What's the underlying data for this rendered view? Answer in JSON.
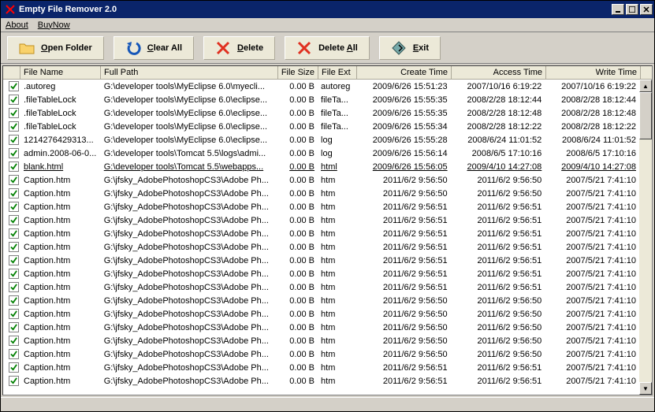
{
  "window": {
    "title": "Empty File Remover 2.0"
  },
  "menu": {
    "about": "About",
    "buynow": "BuyNow"
  },
  "toolbar": {
    "open_folder": "Open Folder",
    "clear_all": "Clear All",
    "delete": "Delete",
    "delete_all": "Delete All",
    "exit": "Exit"
  },
  "columns": {
    "filename": "File Name",
    "fullpath": "Full Path",
    "filesize": "File Size",
    "fileext": "File Ext",
    "create": "Create Time",
    "access": "Access Time",
    "write": "Write Time"
  },
  "selected_index": 6,
  "rows": [
    {
      "f": ".autoreg",
      "p": "G:\\developer tools\\MyEclipse 6.0\\myecli...",
      "s": "0.00 B",
      "e": "autoreg",
      "c": "2009/6/26 15:51:23",
      "a": "2007/10/16 6:19:22",
      "w": "2007/10/16 6:19:22"
    },
    {
      "f": ".fileTableLock",
      "p": "G:\\developer tools\\MyEclipse 6.0\\eclipse...",
      "s": "0.00 B",
      "e": "fileTa...",
      "c": "2009/6/26 15:55:35",
      "a": "2008/2/28 18:12:44",
      "w": "2008/2/28 18:12:44"
    },
    {
      "f": ".fileTableLock",
      "p": "G:\\developer tools\\MyEclipse 6.0\\eclipse...",
      "s": "0.00 B",
      "e": "fileTa...",
      "c": "2009/6/26 15:55:35",
      "a": "2008/2/28 18:12:48",
      "w": "2008/2/28 18:12:48"
    },
    {
      "f": ".fileTableLock",
      "p": "G:\\developer tools\\MyEclipse 6.0\\eclipse...",
      "s": "0.00 B",
      "e": "fileTa...",
      "c": "2009/6/26 15:55:34",
      "a": "2008/2/28 18:12:22",
      "w": "2008/2/28 18:12:22"
    },
    {
      "f": "1214276429313...",
      "p": "G:\\developer tools\\MyEclipse 6.0\\eclipse...",
      "s": "0.00 B",
      "e": "log",
      "c": "2009/6/26 15:55:28",
      "a": "2008/6/24 11:01:52",
      "w": "2008/6/24 11:01:52"
    },
    {
      "f": "admin.2008-06-0...",
      "p": "G:\\developer tools\\Tomcat 5.5\\logs\\admi...",
      "s": "0.00 B",
      "e": "log",
      "c": "2009/6/26 15:56:14",
      "a": "2008/6/5 17:10:16",
      "w": "2008/6/5 17:10:16"
    },
    {
      "f": "blank.html",
      "p": "G:\\developer tools\\Tomcat 5.5\\webapps...",
      "s": "0.00 B",
      "e": "html",
      "c": "2009/6/26 15:56:05",
      "a": "2009/4/10 14:27:08",
      "w": "2009/4/10 14:27:08"
    },
    {
      "f": "Caption.htm",
      "p": "G:\\jfsky_AdobePhotoshopCS3\\Adobe Ph...",
      "s": "0.00 B",
      "e": "htm",
      "c": "2011/6/2 9:56:50",
      "a": "2011/6/2 9:56:50",
      "w": "2007/5/21 7:41:10"
    },
    {
      "f": "Caption.htm",
      "p": "G:\\jfsky_AdobePhotoshopCS3\\Adobe Ph...",
      "s": "0.00 B",
      "e": "htm",
      "c": "2011/6/2 9:56:50",
      "a": "2011/6/2 9:56:50",
      "w": "2007/5/21 7:41:10"
    },
    {
      "f": "Caption.htm",
      "p": "G:\\jfsky_AdobePhotoshopCS3\\Adobe Ph...",
      "s": "0.00 B",
      "e": "htm",
      "c": "2011/6/2 9:56:51",
      "a": "2011/6/2 9:56:51",
      "w": "2007/5/21 7:41:10"
    },
    {
      "f": "Caption.htm",
      "p": "G:\\jfsky_AdobePhotoshopCS3\\Adobe Ph...",
      "s": "0.00 B",
      "e": "htm",
      "c": "2011/6/2 9:56:51",
      "a": "2011/6/2 9:56:51",
      "w": "2007/5/21 7:41:10"
    },
    {
      "f": "Caption.htm",
      "p": "G:\\jfsky_AdobePhotoshopCS3\\Adobe Ph...",
      "s": "0.00 B",
      "e": "htm",
      "c": "2011/6/2 9:56:51",
      "a": "2011/6/2 9:56:51",
      "w": "2007/5/21 7:41:10"
    },
    {
      "f": "Caption.htm",
      "p": "G:\\jfsky_AdobePhotoshopCS3\\Adobe Ph...",
      "s": "0.00 B",
      "e": "htm",
      "c": "2011/6/2 9:56:51",
      "a": "2011/6/2 9:56:51",
      "w": "2007/5/21 7:41:10"
    },
    {
      "f": "Caption.htm",
      "p": "G:\\jfsky_AdobePhotoshopCS3\\Adobe Ph...",
      "s": "0.00 B",
      "e": "htm",
      "c": "2011/6/2 9:56:51",
      "a": "2011/6/2 9:56:51",
      "w": "2007/5/21 7:41:10"
    },
    {
      "f": "Caption.htm",
      "p": "G:\\jfsky_AdobePhotoshopCS3\\Adobe Ph...",
      "s": "0.00 B",
      "e": "htm",
      "c": "2011/6/2 9:56:51",
      "a": "2011/6/2 9:56:51",
      "w": "2007/5/21 7:41:10"
    },
    {
      "f": "Caption.htm",
      "p": "G:\\jfsky_AdobePhotoshopCS3\\Adobe Ph...",
      "s": "0.00 B",
      "e": "htm",
      "c": "2011/6/2 9:56:51",
      "a": "2011/6/2 9:56:51",
      "w": "2007/5/21 7:41:10"
    },
    {
      "f": "Caption.htm",
      "p": "G:\\jfsky_AdobePhotoshopCS3\\Adobe Ph...",
      "s": "0.00 B",
      "e": "htm",
      "c": "2011/6/2 9:56:50",
      "a": "2011/6/2 9:56:50",
      "w": "2007/5/21 7:41:10"
    },
    {
      "f": "Caption.htm",
      "p": "G:\\jfsky_AdobePhotoshopCS3\\Adobe Ph...",
      "s": "0.00 B",
      "e": "htm",
      "c": "2011/6/2 9:56:50",
      "a": "2011/6/2 9:56:50",
      "w": "2007/5/21 7:41:10"
    },
    {
      "f": "Caption.htm",
      "p": "G:\\jfsky_AdobePhotoshopCS3\\Adobe Ph...",
      "s": "0.00 B",
      "e": "htm",
      "c": "2011/6/2 9:56:50",
      "a": "2011/6/2 9:56:50",
      "w": "2007/5/21 7:41:10"
    },
    {
      "f": "Caption.htm",
      "p": "G:\\jfsky_AdobePhotoshopCS3\\Adobe Ph...",
      "s": "0.00 B",
      "e": "htm",
      "c": "2011/6/2 9:56:50",
      "a": "2011/6/2 9:56:50",
      "w": "2007/5/21 7:41:10"
    },
    {
      "f": "Caption.htm",
      "p": "G:\\jfsky_AdobePhotoshopCS3\\Adobe Ph...",
      "s": "0.00 B",
      "e": "htm",
      "c": "2011/6/2 9:56:50",
      "a": "2011/6/2 9:56:50",
      "w": "2007/5/21 7:41:10"
    },
    {
      "f": "Caption.htm",
      "p": "G:\\jfsky_AdobePhotoshopCS3\\Adobe Ph...",
      "s": "0.00 B",
      "e": "htm",
      "c": "2011/6/2 9:56:51",
      "a": "2011/6/2 9:56:51",
      "w": "2007/5/21 7:41:10"
    },
    {
      "f": "Caption.htm",
      "p": "G:\\jfsky_AdobePhotoshopCS3\\Adobe Ph...",
      "s": "0.00 B",
      "e": "htm",
      "c": "2011/6/2 9:56:51",
      "a": "2011/6/2 9:56:51",
      "w": "2007/5/21 7:41:10"
    }
  ]
}
